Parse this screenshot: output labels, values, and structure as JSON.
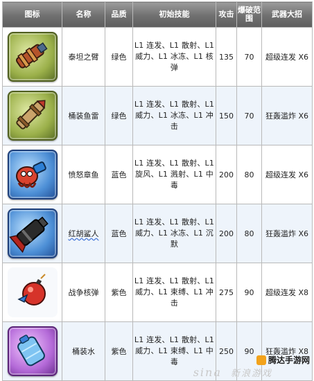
{
  "headers": {
    "icon": "图标",
    "name": "名称",
    "quality": "品质",
    "skills": "初始技能",
    "attack": "攻击",
    "blast": "爆破范围",
    "ult": "武器大招"
  },
  "rows": [
    {
      "icon": "titan-arm-icon",
      "frame": "green",
      "name": "泰坦之臂",
      "quality": "绿色",
      "skills": [
        "L1 连发、L1 散射、L1",
        "威力、L1 冰冻、L1 核",
        "弹"
      ],
      "attack": "135",
      "blast": "70",
      "ult": "超级连发 X6"
    },
    {
      "icon": "barrel-torpedo-icon",
      "frame": "green",
      "name": "桶装鱼雷",
      "quality": "绿色",
      "skills": [
        "L1 连发、L1 散射、L1",
        "威力、L1 冰冻、L1 冲",
        "击"
      ],
      "attack": "150",
      "blast": "70",
      "ult": "狂轰滥炸 X6"
    },
    {
      "icon": "angry-octopus-icon",
      "frame": "blue",
      "name": "愤怒章鱼",
      "quality": "蓝色",
      "skills": [
        "L1 连发、L1 散射、L1",
        "旋风、L1 溅射、L1 中",
        "毒"
      ],
      "attack": "200",
      "blast": "80",
      "ult": "超级连发 X6"
    },
    {
      "icon": "red-beard-shark-icon",
      "frame": "blue",
      "name": "红胡鲨人",
      "quality": "蓝色",
      "skills": [
        "L1 连发、L1 散射、L1",
        "威力、L1 冰冻、L1 沉",
        "默"
      ],
      "attack": "200",
      "blast": "80",
      "ult": "狂轰滥炸 X6"
    },
    {
      "icon": "war-nuke-icon",
      "frame": "purple",
      "name": "战争核弹",
      "quality": "紫色",
      "skills": [
        "L1 连发、L1 散射、L1",
        "威力、L1 束缚、L1 冲",
        "击"
      ],
      "attack": "275",
      "blast": "90",
      "ult": "超级连发 X8"
    },
    {
      "icon": "barrel-water-icon",
      "frame": "purple",
      "name": "桶装水",
      "quality": "紫色",
      "skills": [
        "L1 连发、L1 散射、L1",
        "威力、L1 束缚、L1 中",
        "毒"
      ],
      "attack": "250",
      "blast": "90",
      "ult": "狂轰滥炸 X8"
    }
  ],
  "watermark": {
    "site": "腾达手游网",
    "brand": "sina",
    "faded": "新浪游戏"
  },
  "colors": {
    "header": "#7a7a7a",
    "alt_row": "#eef4fb",
    "green_frame": "#9bb04a",
    "blue_frame": "#4d8fd6",
    "purple_frame": "#b46ad8"
  }
}
